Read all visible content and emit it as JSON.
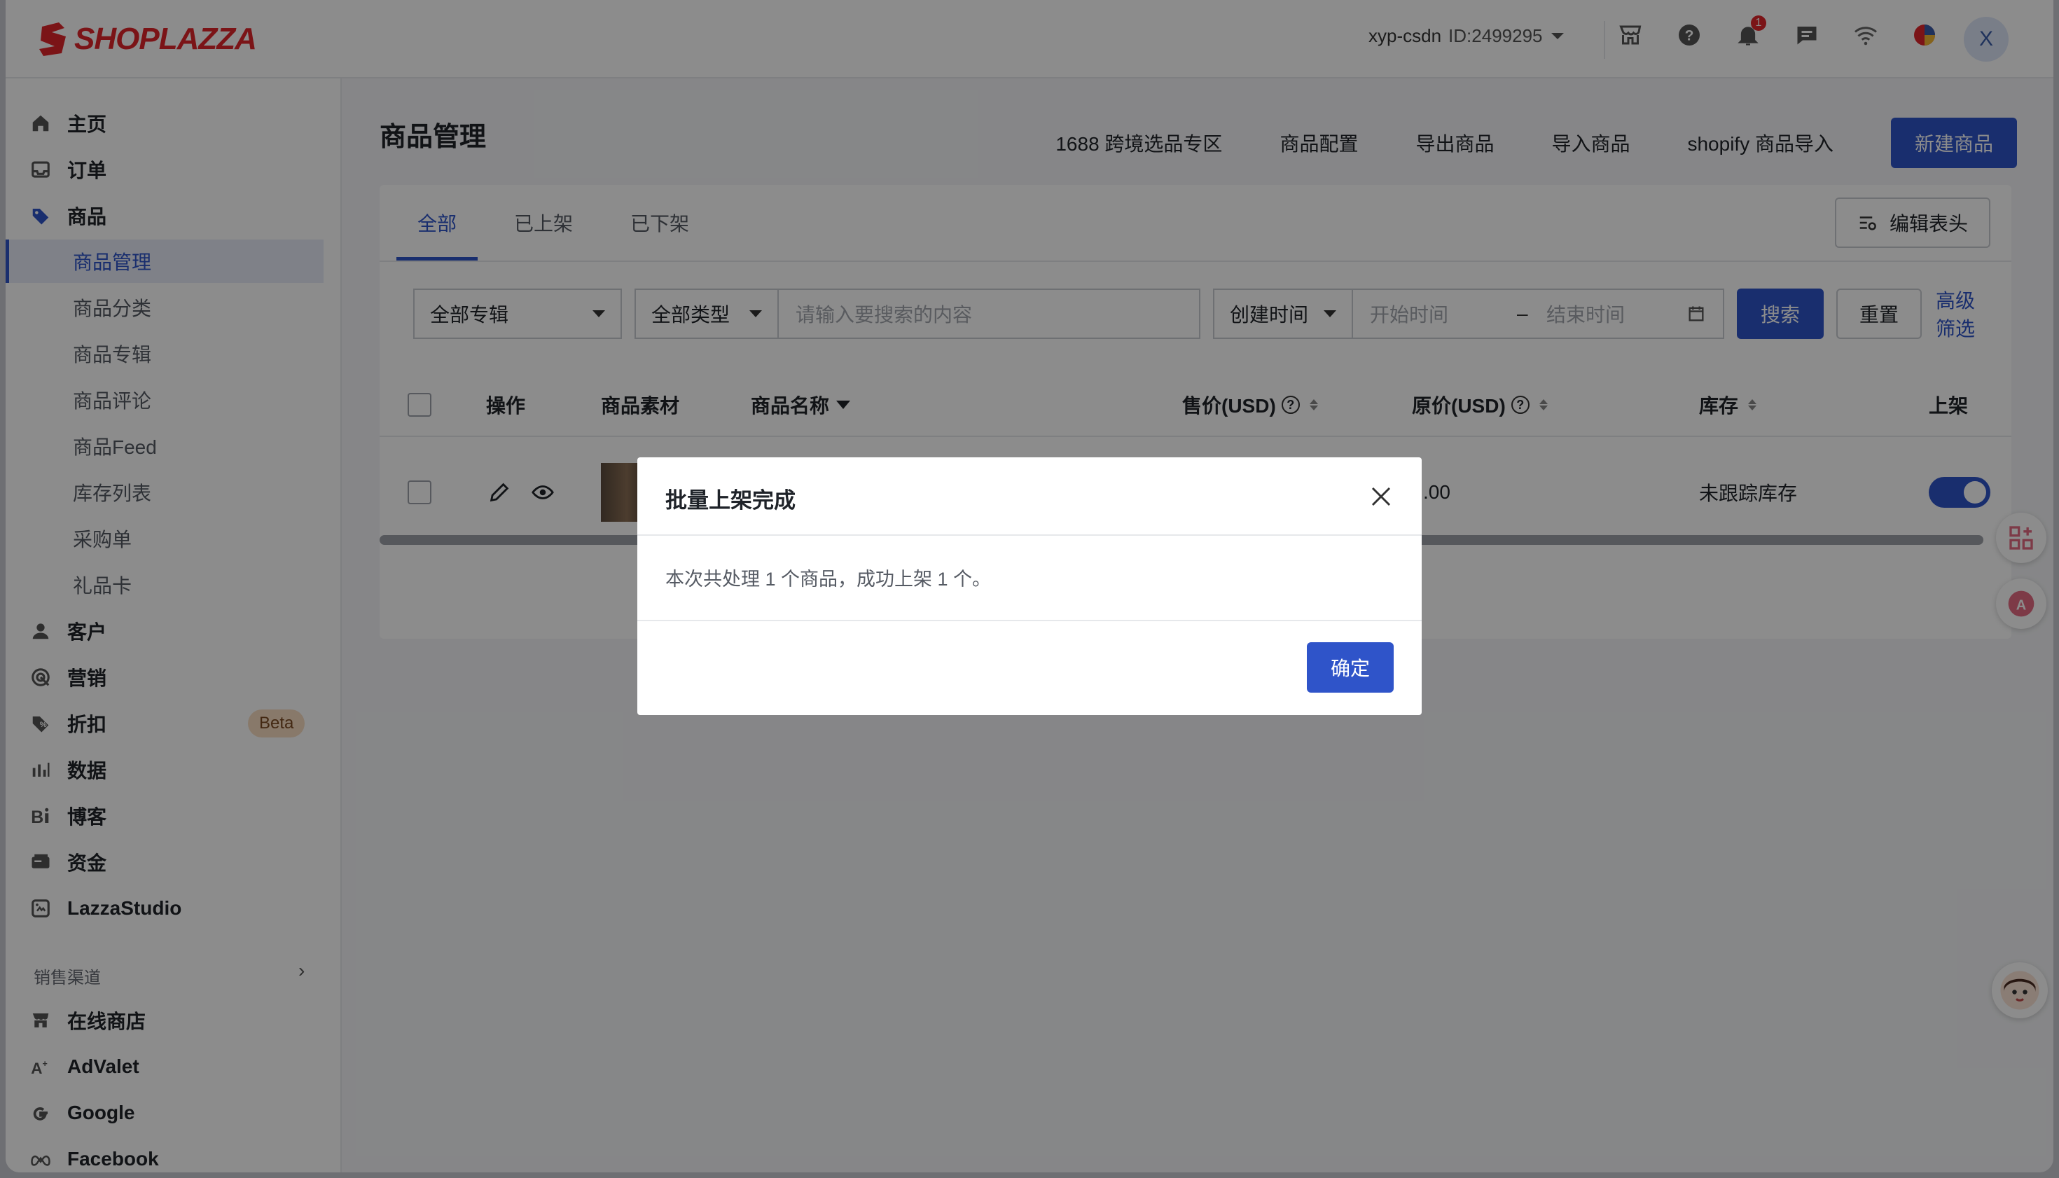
{
  "topbar": {
    "logo": "SHOPLAZZA",
    "store_name": "xyp-csdn",
    "store_id": "ID:2499295",
    "notification_count": "1",
    "avatar_letter": "X"
  },
  "sidebar": {
    "items": [
      {
        "label": "主页",
        "icon": "home-icon"
      },
      {
        "label": "订单",
        "icon": "inbox-icon"
      },
      {
        "label": "商品",
        "icon": "tag-icon"
      },
      {
        "label": "客户",
        "icon": "user-icon"
      },
      {
        "label": "营销",
        "icon": "target-icon"
      },
      {
        "label": "折扣",
        "icon": "discount-icon"
      },
      {
        "label": "数据",
        "icon": "chart-icon"
      },
      {
        "label": "博客",
        "icon": "blog-icon"
      },
      {
        "label": "资金",
        "icon": "wallet-icon"
      },
      {
        "label": "LazzaStudio",
        "icon": "studio-icon"
      }
    ],
    "sub_items": [
      "商品管理",
      "商品分类",
      "商品专辑",
      "商品评论",
      "商品Feed",
      "库存列表",
      "采购单",
      "礼品卡"
    ],
    "beta_label": "Beta",
    "channels_title": "销售渠道",
    "channels": [
      {
        "label": "在线商店",
        "icon": "store-icon"
      },
      {
        "label": "AdValet",
        "icon": "advalet-icon"
      },
      {
        "label": "Google",
        "icon": "google-icon"
      },
      {
        "label": "Facebook",
        "icon": "meta-icon"
      }
    ]
  },
  "main": {
    "title": "商品管理",
    "actions": [
      "1688 跨境选品专区",
      "商品配置",
      "导出商品",
      "导入商品",
      "shopify 商品导入"
    ],
    "new_button": "新建商品",
    "tabs": [
      "全部",
      "已上架",
      "已下架"
    ],
    "active_tab": 0,
    "edit_header": "编辑表头",
    "filters": {
      "collection": "全部专辑",
      "type": "全部类型",
      "search_placeholder": "请输入要搜索的内容",
      "time_type": "创建时间",
      "start_placeholder": "开始时间",
      "range_sep": "–",
      "end_placeholder": "结束时间",
      "search_button": "搜索",
      "reset_button": "重置",
      "advanced": "高级筛选"
    },
    "columns": [
      "操作",
      "商品素材",
      "商品名称",
      "售价(USD)",
      "原价(USD)",
      "库存",
      "上架"
    ],
    "row": {
      "price_partial": ".00",
      "stock": "未跟踪库存",
      "published": true
    }
  },
  "modal": {
    "title": "批量上架完成",
    "body": "本次共处理 1 个商品，成功上架 1 个。",
    "ok": "确定"
  },
  "colors": {
    "brand": "#e0262b",
    "primary": "#2f54c9"
  }
}
